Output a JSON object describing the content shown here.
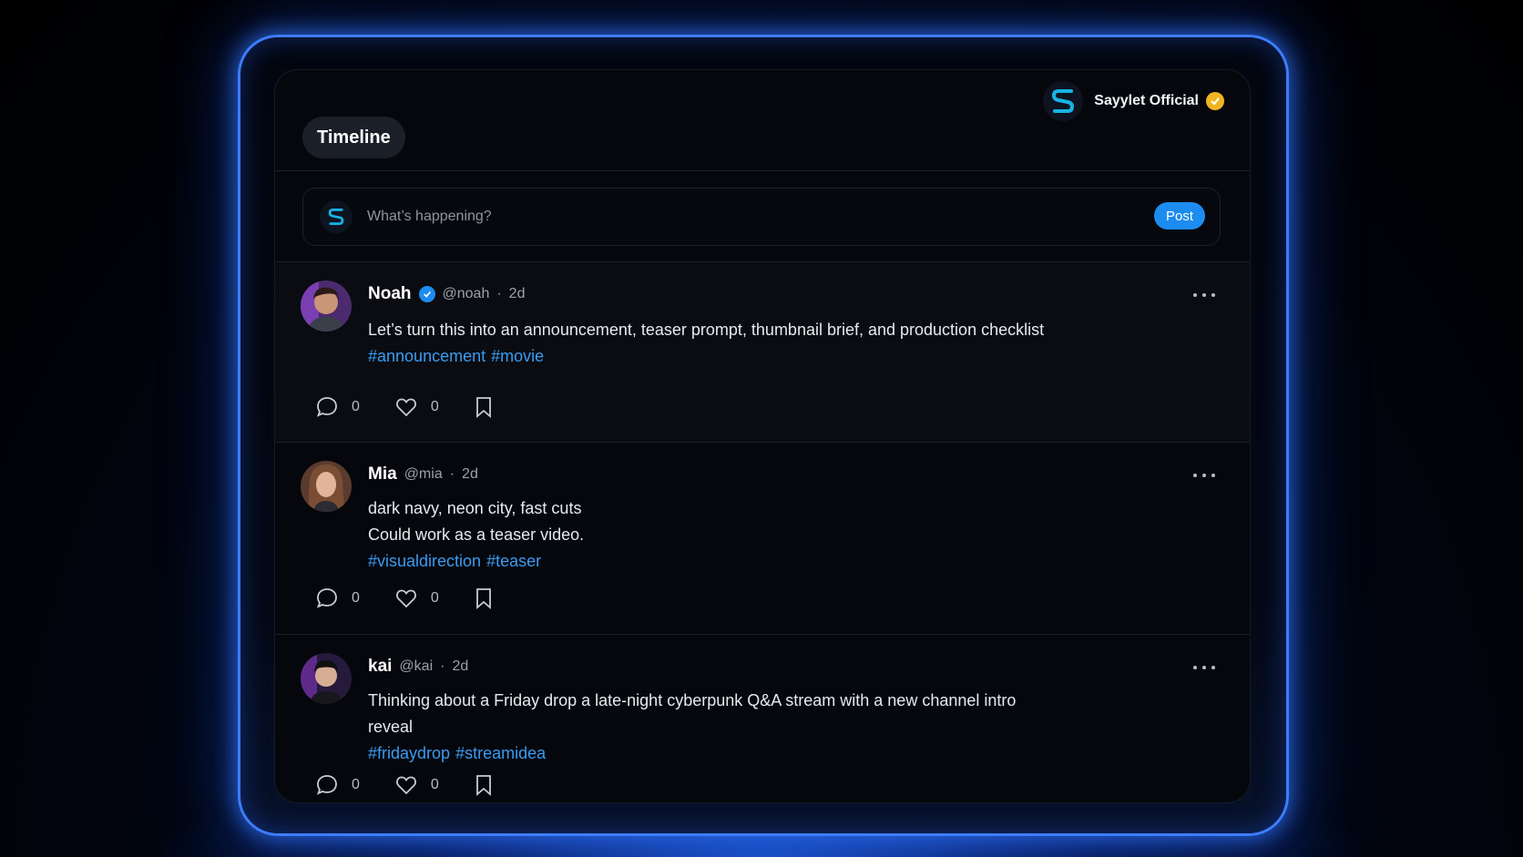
{
  "brand": {
    "name": "Sayylet Official",
    "logo_icon": "sayylet-s-logo",
    "verified_color": "#f1b521"
  },
  "tabs": {
    "active": "Timeline"
  },
  "composer": {
    "placeholder": "What’s happening?",
    "post_label": "Post"
  },
  "colors": {
    "accent": "#1d8cf0",
    "hashtag": "#3a9bf2",
    "frame_glow": "#3d7dff"
  },
  "posts": [
    {
      "name": "Noah",
      "verified": true,
      "handle": "@noah",
      "time": "2d",
      "lines": [
        "Let’s turn this into an announcement, teaser prompt, thumbnail brief, and production checklist"
      ],
      "tags": [
        "#announcement",
        "#movie"
      ],
      "comments": "0",
      "likes": "0"
    },
    {
      "name": "Mia",
      "verified": false,
      "handle": "@mia",
      "time": "2d",
      "lines": [
        "dark navy, neon city, fast cuts",
        "Could work as a teaser video."
      ],
      "tags": [
        "#visualdirection",
        "#teaser"
      ],
      "comments": "0",
      "likes": "0"
    },
    {
      "name": "kai",
      "verified": false,
      "handle": "@kai",
      "time": "2d",
      "lines": [
        "Thinking about a Friday drop a late-night cyberpunk Q&A stream with a new channel intro",
        "reveal"
      ],
      "tags": [
        "#fridaydrop",
        "#streamidea"
      ],
      "comments": "0",
      "likes": "0"
    }
  ],
  "separator": "·"
}
